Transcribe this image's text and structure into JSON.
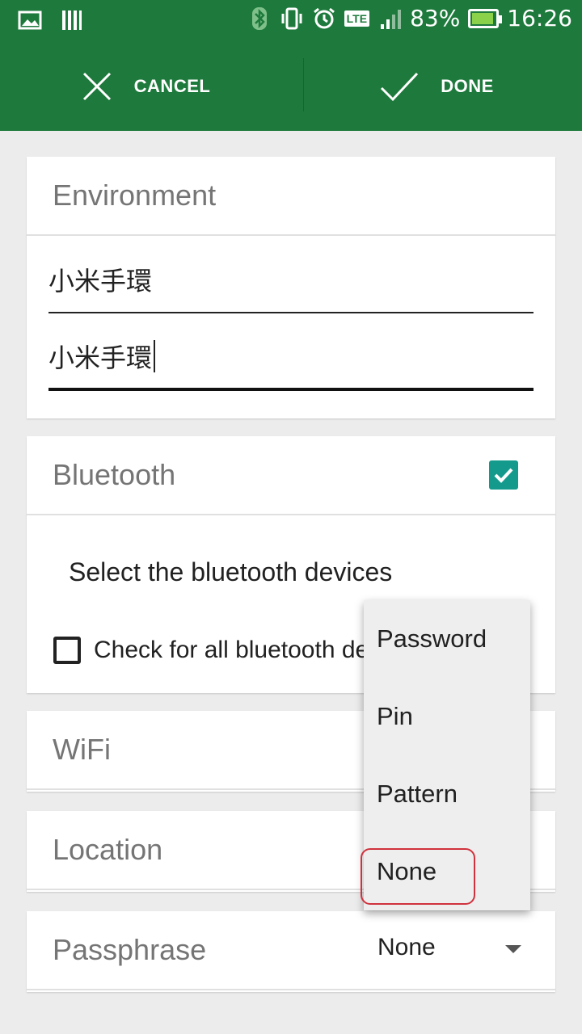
{
  "status_bar": {
    "battery_percent": "83%",
    "time": "16:26",
    "network": "LTE"
  },
  "action_bar": {
    "cancel_label": "CANCEL",
    "done_label": "DONE"
  },
  "environment": {
    "header": "Environment",
    "name_value": "小米手環",
    "description_value": "小米手環"
  },
  "bluetooth": {
    "header": "Bluetooth",
    "enabled": true,
    "select_label": "Select the bluetooth devices",
    "check_all_label": "Check for all bluetooth devices"
  },
  "wifi": {
    "header": "WiFi"
  },
  "location": {
    "header": "Location"
  },
  "passphrase": {
    "header": "Passphrase",
    "selected": "None"
  },
  "popup_menu": {
    "items": [
      "Password",
      "Pin",
      "Pattern",
      "None"
    ],
    "highlighted_index": 3
  },
  "colors": {
    "primary": "#1e7a3c",
    "accent": "#139a8c",
    "highlight": "#d0323d"
  }
}
